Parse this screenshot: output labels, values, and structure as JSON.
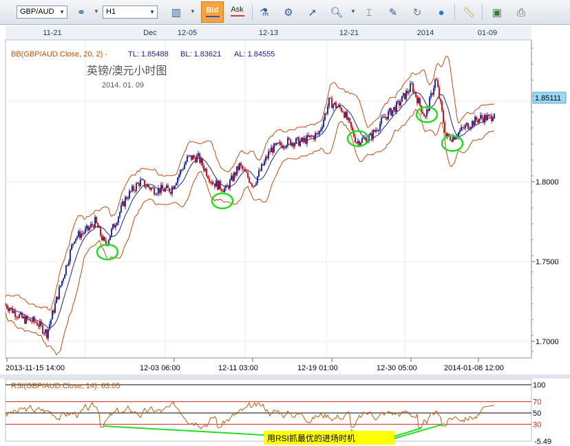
{
  "toolbar": {
    "symbol": "GBP/AUD",
    "timeframe": "H1",
    "bid_label": "Bid",
    "ask_label": "Ask",
    "icons": [
      "bar-chart-type-icon",
      "connect-icon",
      "indicators-icon",
      "objects-icon",
      "cursor-icon",
      "zoom-icon",
      "crosshair-icon",
      "template-icon",
      "tools-icon",
      "globe-icon",
      "ruler-icon",
      "screenshot-icon",
      "print-icon"
    ]
  },
  "top_dates": [
    "11-21",
    "Dec",
    "12-05",
    "12-13",
    "12-21",
    "2014",
    "01-09"
  ],
  "bottom_dates": [
    "2013-11-15 14:00",
    "12-03 06:00",
    "12-11 03:00",
    "12-19 01:00",
    "12-30 05:00",
    "2014-01-08 12:00"
  ],
  "main_panel": {
    "indicator_label": "BB(GBP/AUD.Close, 20, 2) -",
    "tl_label": "TL: 1.85488",
    "bl_label": "BL: 1.83621",
    "al_label": "AL: 1.84555",
    "chart_title": "英镑/澳元小时图",
    "chart_date": "2014. 01. 09",
    "price_ticks": [
      "1.8000",
      "1.7500",
      "1.7000"
    ],
    "current_price": "1.85111"
  },
  "rsi_panel": {
    "label": "RSI(GBP/AUD.Close, 14): 63.05",
    "levels": [
      "100",
      "70",
      "50",
      "30"
    ],
    "bottom_value": "-5.49",
    "annotation": "用RSI抓最优的进场时机"
  },
  "colors": {
    "bull_candle": "#1f2fa8",
    "bear_candle": "#d01818",
    "band_color": "#c04a10",
    "mid_color": "#1a237e",
    "highlight_circle": "#22dd22",
    "price_badge": "#9ad8f4",
    "rsi_line": "#c05a10",
    "annotation_bg": "#ffff00"
  },
  "chart_data": {
    "type": "candlestick",
    "symbol": "GBP/AUD",
    "timeframe": "H1",
    "ylim": [
      1.68,
      1.88
    ],
    "x_ticks": [
      "2013-11-15 14:00",
      "12-03 06:00",
      "12-11 03:00",
      "12-19 01:00",
      "12-30 05:00",
      "2014-01-08 12:00"
    ],
    "y_ticks": [
      1.7,
      1.75,
      1.8
    ],
    "price_path": [
      [
        0,
        1.723
      ],
      [
        25,
        1.714
      ],
      [
        45,
        1.712
      ],
      [
        60,
        1.705
      ],
      [
        80,
        1.735
      ],
      [
        100,
        1.765
      ],
      [
        120,
        1.77
      ],
      [
        130,
        1.775
      ],
      [
        145,
        1.76
      ],
      [
        160,
        1.775
      ],
      [
        175,
        1.79
      ],
      [
        195,
        1.8
      ],
      [
        215,
        1.795
      ],
      [
        240,
        1.795
      ],
      [
        265,
        1.815
      ],
      [
        280,
        1.815
      ],
      [
        300,
        1.8
      ],
      [
        320,
        1.795
      ],
      [
        340,
        1.81
      ],
      [
        360,
        1.798
      ],
      [
        385,
        1.82
      ],
      [
        410,
        1.825
      ],
      [
        430,
        1.825
      ],
      [
        455,
        1.83
      ],
      [
        470,
        1.85
      ],
      [
        490,
        1.845
      ],
      [
        510,
        1.825
      ],
      [
        530,
        1.828
      ],
      [
        550,
        1.84
      ],
      [
        570,
        1.848
      ],
      [
        590,
        1.86
      ],
      [
        610,
        1.84
      ],
      [
        625,
        1.865
      ],
      [
        640,
        1.828
      ],
      [
        650,
        1.828
      ],
      [
        670,
        1.835
      ],
      [
        690,
        1.84
      ],
      [
        705,
        1.84
      ],
      [
        718,
        1.8511
      ]
    ],
    "bollinger": {
      "period": 20,
      "deviation": 2,
      "top": 1.85488,
      "bottom": 1.83621,
      "average": 1.84555
    },
    "rsi": {
      "period": 14,
      "last_value": 63.05,
      "levels": [
        30,
        50,
        70
      ]
    },
    "highlighted_entries": [
      {
        "time_index": 148,
        "price": 1.756
      },
      {
        "time_index": 315,
        "price": 1.788
      },
      {
        "time_index": 512,
        "price": 1.827
      },
      {
        "time_index": 612,
        "price": 1.842
      },
      {
        "time_index": 649,
        "price": 1.824
      }
    ]
  }
}
